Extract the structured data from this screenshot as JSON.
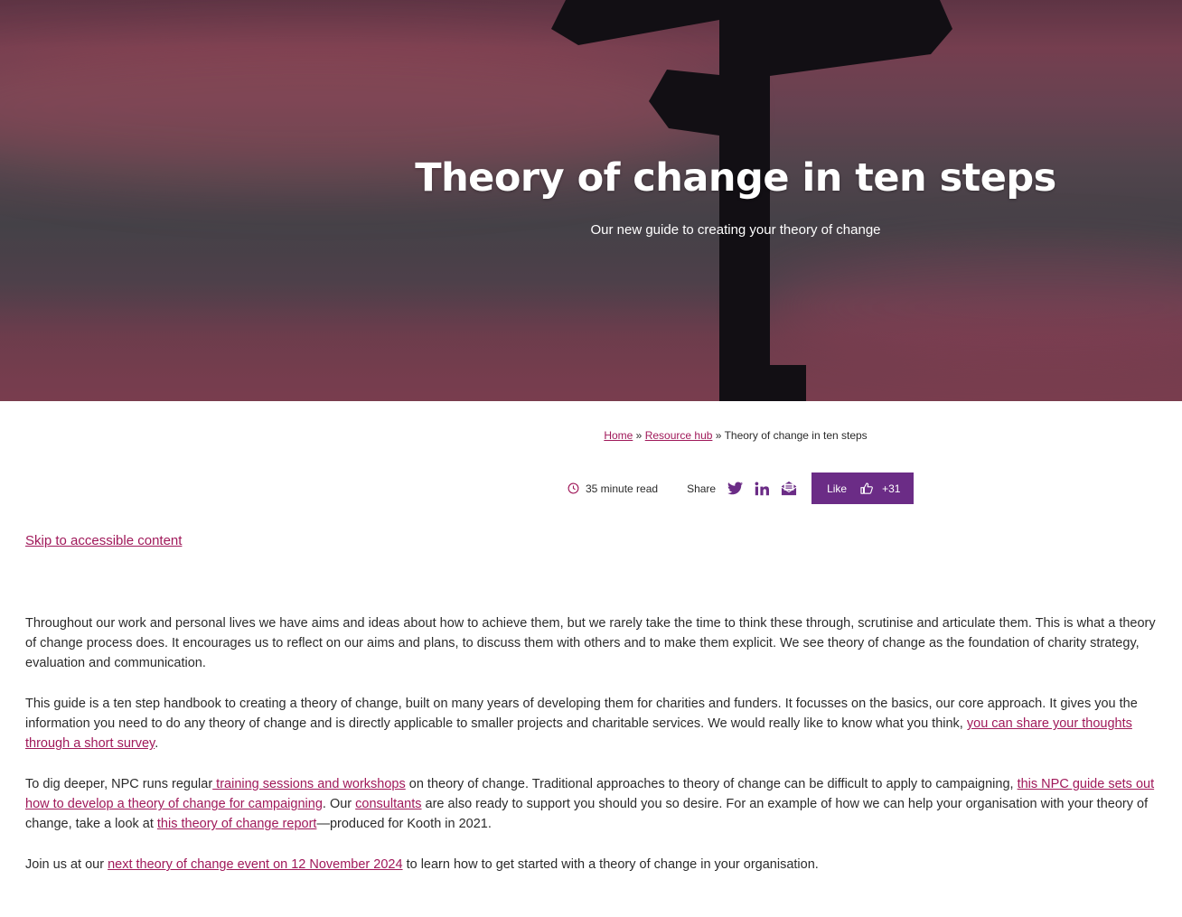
{
  "hero": {
    "title": "Theory of change in ten steps",
    "subtitle": "Our new guide to creating your theory of change"
  },
  "breadcrumb": {
    "home": "Home",
    "separator": "»",
    "resource_hub": "Resource hub",
    "current": "Theory of change in ten steps"
  },
  "meta": {
    "read_time": "35 minute read",
    "share_label": "Share",
    "share_icons": [
      "twitter-icon",
      "linkedin-icon",
      "email-icon"
    ],
    "like_label": "Like",
    "like_count": "+31"
  },
  "skip_link": "Skip to accessible content",
  "article": {
    "p1": "Throughout our work and personal lives we have aims and ideas about how to achieve them, but we rarely take the time to think these through, scrutinise and articulate them. This is what a theory of change process does. It encourages us to reflect on our aims and plans, to discuss them with others and to make them explicit. We see theory of change as the foundation of charity strategy, evaluation and communication.",
    "p2_text": "This guide is a ten step handbook to creating a theory of change, built on many years of developing them for charities and funders. It focusses on the basics, our core approach. It gives you the information you need to do any theory of change and is directly applicable to smaller projects and charitable services. We would really like to know what you think, ",
    "p2_link": "you can share your thoughts through a short survey",
    "p2_end": ".",
    "p3_a": "To dig deeper, NPC runs regular",
    "p3_link1": " training sessions and workshops",
    "p3_b": " on theory of change. Traditional approaches to theory of change can be difficult to apply to campaigning, ",
    "p3_link2": "this NPC guide sets out how to develop a theory of change for campaigning",
    "p3_c": ". Our ",
    "p3_link3": "consultants",
    "p3_d": " are also ready to support you should you so desire. For an example of how we can help your organisation with your theory of change, take a look at ",
    "p3_link4": "this theory of change report",
    "p3_e": "—produced for Kooth in 2021.",
    "p4_a": "Join us at our ",
    "p4_link": "next theory of change event on 12 November 2024",
    "p4_b": " to learn how to get started with a theory of change in your organisation."
  },
  "colors": {
    "accent": "#6b2c86",
    "link": "#a0195a",
    "text": "#2b2b2b"
  }
}
